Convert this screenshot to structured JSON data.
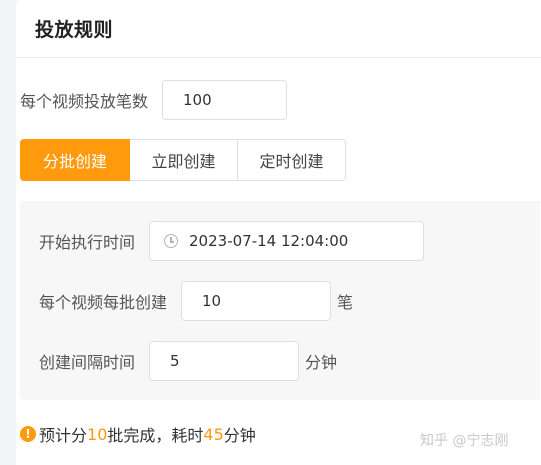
{
  "card": {
    "title": "投放规则"
  },
  "count": {
    "label": "每个视频投放笔数",
    "value": "100"
  },
  "tabs": [
    {
      "label": "分批创建",
      "active": true
    },
    {
      "label": "立即创建",
      "active": false
    },
    {
      "label": "定时创建",
      "active": false
    }
  ],
  "batch_panel": {
    "start_label": "开始执行时间",
    "start_value": "2023-07-14 12:04:00",
    "per_batch_label": "每个视频每批创建",
    "per_batch_value": "10",
    "per_batch_unit": "笔",
    "interval_label": "创建间隔时间",
    "interval_value": "5",
    "interval_unit": "分钟"
  },
  "summary": {
    "icon": "!",
    "prefix": "预计分",
    "batches": "10",
    "middle": "批完成，耗时",
    "minutes": "45",
    "suffix": "分钟"
  },
  "watermark": {
    "text": "知乎 @宁志刚"
  },
  "colors": {
    "accent": "#ff9a0d",
    "panel_bg": "#f7f7f8",
    "border": "#dcdfe6"
  },
  "icons": {
    "time_input": "clock-icon",
    "summary": "warning-icon"
  }
}
